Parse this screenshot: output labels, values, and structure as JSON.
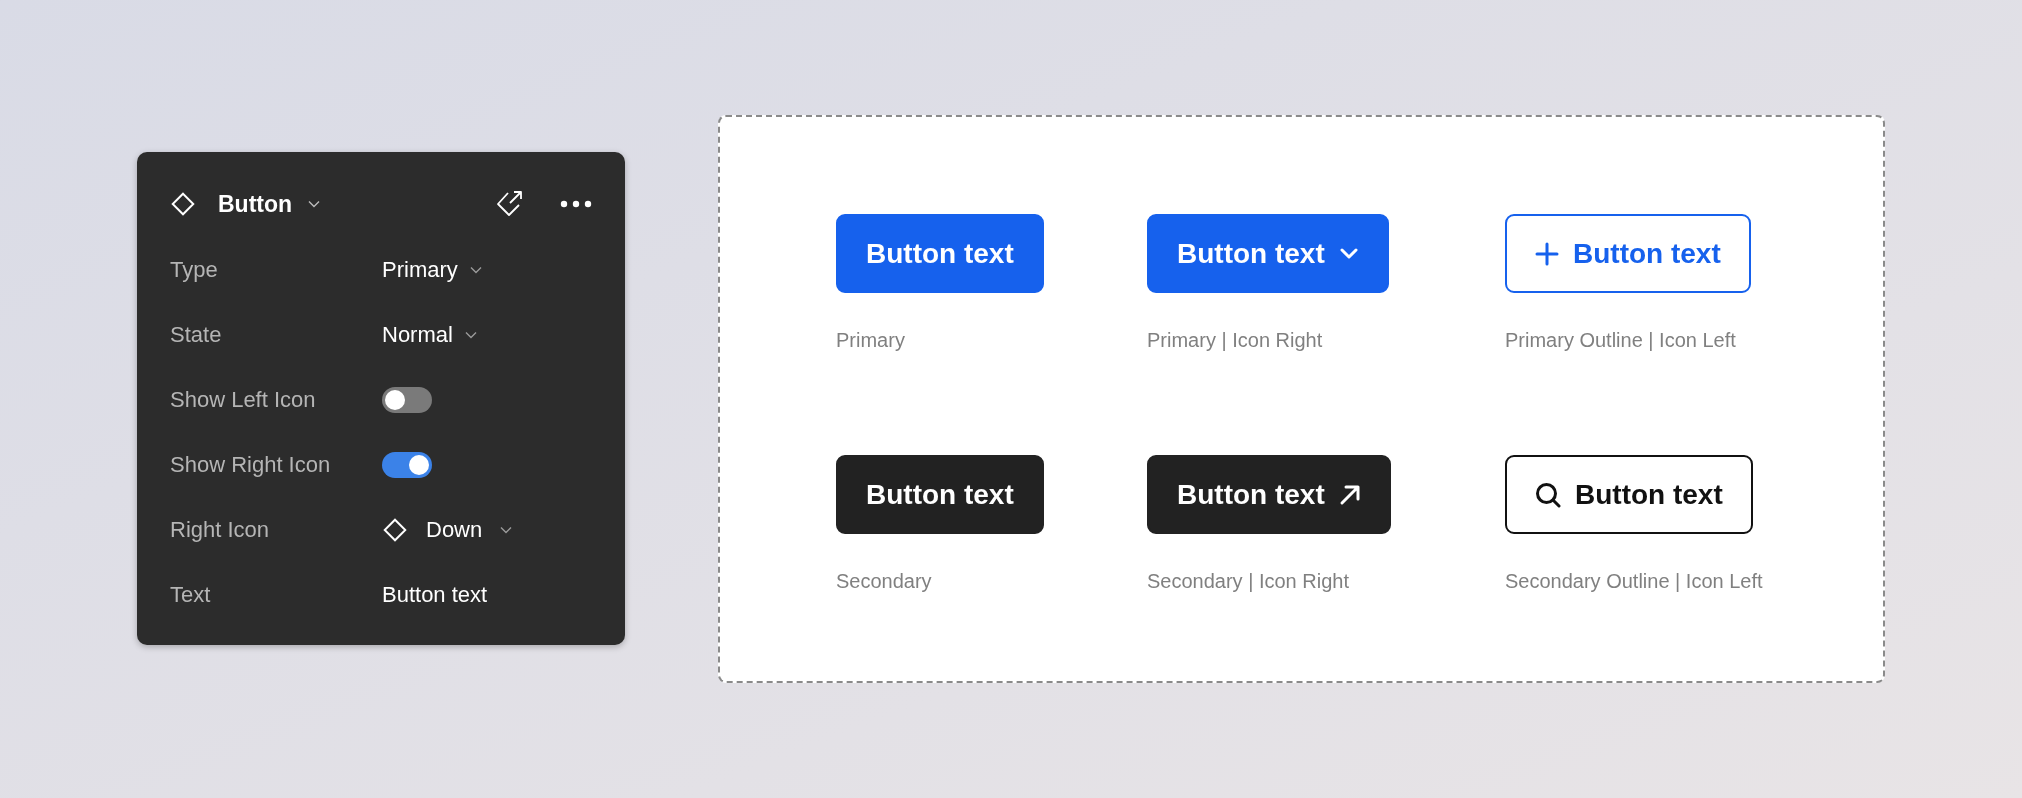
{
  "panel": {
    "title": "Button",
    "properties": [
      {
        "kind": "select",
        "label": "Type",
        "value": "Primary"
      },
      {
        "kind": "select",
        "label": "State",
        "value": "Normal"
      },
      {
        "kind": "toggle",
        "label": "Show Left Icon",
        "on": false
      },
      {
        "kind": "toggle",
        "label": "Show Right Icon",
        "on": true
      },
      {
        "kind": "icon-select",
        "label": "Right Icon",
        "value": "Down"
      },
      {
        "kind": "text",
        "label": "Text",
        "value": "Button text"
      }
    ]
  },
  "variants": [
    {
      "kind": "primary",
      "text": "Button text",
      "caption": "Primary"
    },
    {
      "kind": "primary",
      "text": "Button text",
      "caption": "Primary | Icon Right"
    },
    {
      "kind": "primary-outline",
      "text": "Button text",
      "caption": "Primary Outline | Icon Left"
    },
    {
      "kind": "secondary",
      "text": "Button text",
      "caption": "Secondary"
    },
    {
      "kind": "secondary",
      "text": "Button text",
      "caption": "Secondary | Icon Right"
    },
    {
      "kind": "secondary-outline",
      "text": "Button text",
      "caption": "Secondary Outline | Icon Left"
    }
  ]
}
